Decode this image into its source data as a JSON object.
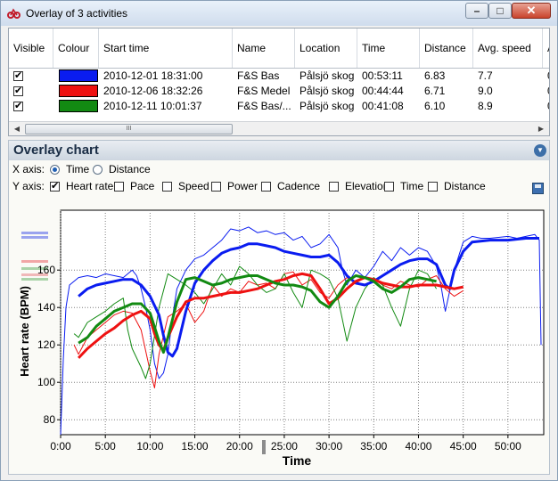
{
  "window": {
    "title": "Overlay of 3 activities",
    "buttons": {
      "minimize": "–",
      "maximize": "□",
      "close": "✕"
    }
  },
  "grid": {
    "columns": [
      "Visible",
      "Colour",
      "Start time",
      "Name",
      "Location",
      "Time",
      "Distance",
      "Avg. speed",
      "A"
    ],
    "rows": [
      {
        "visible": true,
        "colour": "#0a1cf0",
        "start_time": "2010-12-01 18:31:00",
        "name": "F&S Bas",
        "location": "Pålsjö skog",
        "time": "00:53:11",
        "distance": "6.83",
        "avg_speed": "7.7",
        "extra": "0"
      },
      {
        "visible": true,
        "colour": "#ee1111",
        "start_time": "2010-12-06 18:32:26",
        "name": "F&S Medel",
        "location": "Pålsjö skog",
        "time": "00:44:44",
        "distance": "6.71",
        "avg_speed": "9.0",
        "extra": "0"
      },
      {
        "visible": true,
        "colour": "#128a12",
        "start_time": "2010-12-11 10:01:37",
        "name": "F&S  Bas/...",
        "location": "Pålsjö skog",
        "time": "00:41:08",
        "distance": "6.10",
        "avg_speed": "8.9",
        "extra": "0"
      }
    ],
    "scroll_thumb_glyph": "III"
  },
  "overlay": {
    "title": "Overlay chart",
    "x_axis_label": "X axis:",
    "x_options": [
      {
        "label": "Time",
        "selected": true
      },
      {
        "label": "Distance",
        "selected": false
      }
    ],
    "y_axis_label": "Y axis:",
    "y_options": [
      {
        "label": "Heart rate",
        "checked": true
      },
      {
        "label": "Pace",
        "checked": false
      },
      {
        "label": "Speed",
        "checked": false
      },
      {
        "label": "Power",
        "checked": false
      },
      {
        "label": "Cadence",
        "checked": false
      },
      {
        "label": "Elevation",
        "checked": false
      },
      {
        "label": "Time",
        "checked": false
      },
      {
        "label": "Distance",
        "checked": false
      }
    ],
    "collapse_icon": "chevron-down-icon",
    "save_icon": "save-icon"
  },
  "chart_data": {
    "type": "line",
    "title": "",
    "xlabel": "Time",
    "ylabel": "Heart rate (BPM)",
    "xlim": [
      0,
      54
    ],
    "ylim": [
      72,
      192
    ],
    "x_ticks": [
      "0:00",
      "5:00",
      "10:00",
      "15:00",
      "20:00",
      "25:00",
      "30:00",
      "35:00",
      "40:00",
      "45:00",
      "50:00"
    ],
    "y_ticks": [
      80,
      100,
      120,
      140,
      160
    ],
    "grid": true,
    "series": [
      {
        "color": "#0a1cf0",
        "raw": [
          [
            0,
            72
          ],
          [
            0.3,
            112
          ],
          [
            0.6,
            140
          ],
          [
            1,
            152
          ],
          [
            2,
            156
          ],
          [
            3,
            157
          ],
          [
            4,
            156
          ],
          [
            5,
            158
          ],
          [
            6,
            157
          ],
          [
            7,
            156
          ],
          [
            8,
            160
          ],
          [
            8.5,
            157
          ],
          [
            9,
            150
          ],
          [
            9.5,
            140
          ],
          [
            10,
            128
          ],
          [
            10.5,
            110
          ],
          [
            11,
            102
          ],
          [
            11.5,
            105
          ],
          [
            12,
            115
          ],
          [
            12.5,
            135
          ],
          [
            13,
            150
          ],
          [
            14,
            160
          ],
          [
            15,
            166
          ],
          [
            16,
            168
          ],
          [
            17,
            172
          ],
          [
            18,
            176
          ],
          [
            19,
            182
          ],
          [
            20,
            181
          ],
          [
            21,
            183
          ],
          [
            22,
            180
          ],
          [
            23,
            181
          ],
          [
            24,
            179
          ],
          [
            25,
            180
          ],
          [
            26,
            176
          ],
          [
            27,
            178
          ],
          [
            28,
            172
          ],
          [
            29,
            174
          ],
          [
            30,
            179
          ],
          [
            31,
            172
          ],
          [
            31.5,
            160
          ],
          [
            32,
            152
          ],
          [
            33,
            160
          ],
          [
            34,
            156
          ],
          [
            35,
            162
          ],
          [
            36,
            170
          ],
          [
            37,
            165
          ],
          [
            38,
            172
          ],
          [
            39,
            168
          ],
          [
            40,
            172
          ],
          [
            41,
            170
          ],
          [
            42,
            162
          ],
          [
            42.5,
            152
          ],
          [
            43,
            138
          ],
          [
            44,
            160
          ],
          [
            45,
            175
          ],
          [
            46,
            178
          ],
          [
            47,
            177
          ],
          [
            48,
            177
          ],
          [
            50,
            178
          ],
          [
            51,
            177
          ],
          [
            52,
            178
          ],
          [
            53,
            179
          ],
          [
            53.5,
            176
          ],
          [
            53.7,
            120
          ]
        ],
        "smooth": [
          [
            2,
            146
          ],
          [
            3,
            150
          ],
          [
            4,
            152
          ],
          [
            5,
            153
          ],
          [
            6,
            154
          ],
          [
            7,
            155
          ],
          [
            8,
            155
          ],
          [
            9,
            152
          ],
          [
            10,
            146
          ],
          [
            11,
            136
          ],
          [
            11.5,
            125
          ],
          [
            12,
            116
          ],
          [
            12.5,
            114
          ],
          [
            13,
            118
          ],
          [
            14,
            138
          ],
          [
            15,
            153
          ],
          [
            16,
            160
          ],
          [
            17,
            165
          ],
          [
            18,
            169
          ],
          [
            19,
            171
          ],
          [
            20,
            172
          ],
          [
            21,
            174
          ],
          [
            22,
            174
          ],
          [
            23,
            173
          ],
          [
            24,
            172
          ],
          [
            25,
            170
          ],
          [
            26,
            169
          ],
          [
            27,
            168
          ],
          [
            28,
            167
          ],
          [
            29,
            167
          ],
          [
            30,
            168
          ],
          [
            31,
            164
          ],
          [
            32,
            157
          ],
          [
            33,
            153
          ],
          [
            34,
            152
          ],
          [
            35,
            154
          ],
          [
            36,
            157
          ],
          [
            37,
            160
          ],
          [
            38,
            163
          ],
          [
            39,
            165
          ],
          [
            40,
            166
          ],
          [
            41,
            166
          ],
          [
            42,
            163
          ],
          [
            43,
            152
          ],
          [
            43.5,
            150
          ],
          [
            44,
            160
          ],
          [
            45,
            170
          ],
          [
            46,
            175
          ],
          [
            48,
            176
          ],
          [
            50,
            176
          ],
          [
            52,
            177
          ],
          [
            53.5,
            177
          ]
        ]
      },
      {
        "color": "#ee1111",
        "raw": [
          [
            1.5,
            120
          ],
          [
            2,
            115
          ],
          [
            3,
            124
          ],
          [
            4,
            128
          ],
          [
            5,
            132
          ],
          [
            6,
            136
          ],
          [
            7,
            138
          ],
          [
            8,
            137
          ],
          [
            9,
            128
          ],
          [
            10,
            106
          ],
          [
            10.5,
            97
          ],
          [
            11,
            115
          ],
          [
            12,
            135
          ],
          [
            13,
            138
          ],
          [
            14,
            142
          ],
          [
            15,
            132
          ],
          [
            16,
            138
          ],
          [
            17,
            152
          ],
          [
            18,
            146
          ],
          [
            19,
            150
          ],
          [
            20,
            148
          ],
          [
            21,
            154
          ],
          [
            22,
            152
          ],
          [
            23,
            153
          ],
          [
            24,
            150
          ],
          [
            25,
            158
          ],
          [
            26,
            159
          ],
          [
            27,
            152
          ],
          [
            28,
            155
          ],
          [
            29,
            148
          ],
          [
            30,
            145
          ],
          [
            31,
            152
          ],
          [
            32,
            156
          ],
          [
            33,
            153
          ],
          [
            34,
            156
          ],
          [
            35,
            155
          ],
          [
            36,
            152
          ],
          [
            37,
            150
          ],
          [
            38,
            154
          ],
          [
            39,
            152
          ],
          [
            40,
            151
          ],
          [
            41,
            155
          ],
          [
            42,
            157
          ],
          [
            43,
            150
          ],
          [
            44,
            146
          ],
          [
            45,
            149
          ]
        ],
        "smooth": [
          [
            2,
            113
          ],
          [
            3,
            118
          ],
          [
            4,
            122
          ],
          [
            5,
            126
          ],
          [
            6,
            129
          ],
          [
            7,
            133
          ],
          [
            8,
            136
          ],
          [
            9,
            138
          ],
          [
            10,
            134
          ],
          [
            10.5,
            126
          ],
          [
            11,
            120
          ],
          [
            11.5,
            117
          ],
          [
            12,
            124
          ],
          [
            13,
            135
          ],
          [
            14,
            143
          ],
          [
            15,
            145
          ],
          [
            16,
            145
          ],
          [
            17,
            146
          ],
          [
            18,
            147
          ],
          [
            19,
            148
          ],
          [
            20,
            148
          ],
          [
            21,
            149
          ],
          [
            22,
            150
          ],
          [
            23,
            152
          ],
          [
            24,
            154
          ],
          [
            25,
            155
          ],
          [
            26,
            157
          ],
          [
            27,
            158
          ],
          [
            28,
            157
          ],
          [
            29,
            150
          ],
          [
            30,
            142
          ],
          [
            31,
            145
          ],
          [
            32,
            150
          ],
          [
            33,
            154
          ],
          [
            34,
            156
          ],
          [
            35,
            155
          ],
          [
            36,
            153
          ],
          [
            37,
            152
          ],
          [
            38,
            151
          ],
          [
            39,
            151
          ],
          [
            40,
            152
          ],
          [
            41,
            152
          ],
          [
            42,
            152
          ],
          [
            43,
            151
          ],
          [
            44,
            150
          ],
          [
            45,
            151
          ]
        ]
      },
      {
        "color": "#128a12",
        "raw": [
          [
            1.5,
            126
          ],
          [
            2,
            124
          ],
          [
            3,
            132
          ],
          [
            4,
            135
          ],
          [
            5,
            138
          ],
          [
            6,
            142
          ],
          [
            7,
            145
          ],
          [
            7.5,
            128
          ],
          [
            8,
            118
          ],
          [
            9,
            108
          ],
          [
            9.5,
            102
          ],
          [
            10,
            110
          ],
          [
            11,
            140
          ],
          [
            12,
            158
          ],
          [
            13,
            155
          ],
          [
            14,
            152
          ],
          [
            15,
            148
          ],
          [
            16,
            142
          ],
          [
            17,
            150
          ],
          [
            18,
            158
          ],
          [
            19,
            152
          ],
          [
            20,
            162
          ],
          [
            21,
            158
          ],
          [
            22,
            152
          ],
          [
            23,
            148
          ],
          [
            24,
            150
          ],
          [
            25,
            158
          ],
          [
            26,
            148
          ],
          [
            27,
            140
          ],
          [
            28,
            160
          ],
          [
            29,
            158
          ],
          [
            30,
            155
          ],
          [
            31,
            145
          ],
          [
            32,
            122
          ],
          [
            33,
            140
          ],
          [
            34,
            150
          ],
          [
            35,
            156
          ],
          [
            36,
            152
          ],
          [
            37,
            140
          ],
          [
            38,
            130
          ],
          [
            39,
            150
          ],
          [
            40,
            160
          ],
          [
            41,
            158
          ],
          [
            42,
            150
          ]
        ],
        "smooth": [
          [
            2,
            121
          ],
          [
            3,
            124
          ],
          [
            4,
            130
          ],
          [
            5,
            134
          ],
          [
            6,
            138
          ],
          [
            7,
            140
          ],
          [
            8,
            142
          ],
          [
            9,
            142
          ],
          [
            10,
            137
          ],
          [
            11,
            122
          ],
          [
            11.5,
            116
          ],
          [
            12,
            124
          ],
          [
            13,
            143
          ],
          [
            14,
            155
          ],
          [
            15,
            156
          ],
          [
            16,
            154
          ],
          [
            17,
            152
          ],
          [
            18,
            153
          ],
          [
            19,
            155
          ],
          [
            20,
            156
          ],
          [
            21,
            157
          ],
          [
            22,
            157
          ],
          [
            23,
            155
          ],
          [
            24,
            153
          ],
          [
            25,
            152
          ],
          [
            26,
            152
          ],
          [
            27,
            151
          ],
          [
            28,
            149
          ],
          [
            29,
            143
          ],
          [
            30,
            140
          ],
          [
            31,
            146
          ],
          [
            32,
            154
          ],
          [
            33,
            157
          ],
          [
            34,
            156
          ],
          [
            35,
            154
          ],
          [
            36,
            150
          ],
          [
            37,
            148
          ],
          [
            38,
            151
          ],
          [
            39,
            155
          ],
          [
            40,
            156
          ],
          [
            41,
            155
          ],
          [
            42,
            154
          ]
        ]
      }
    ]
  }
}
